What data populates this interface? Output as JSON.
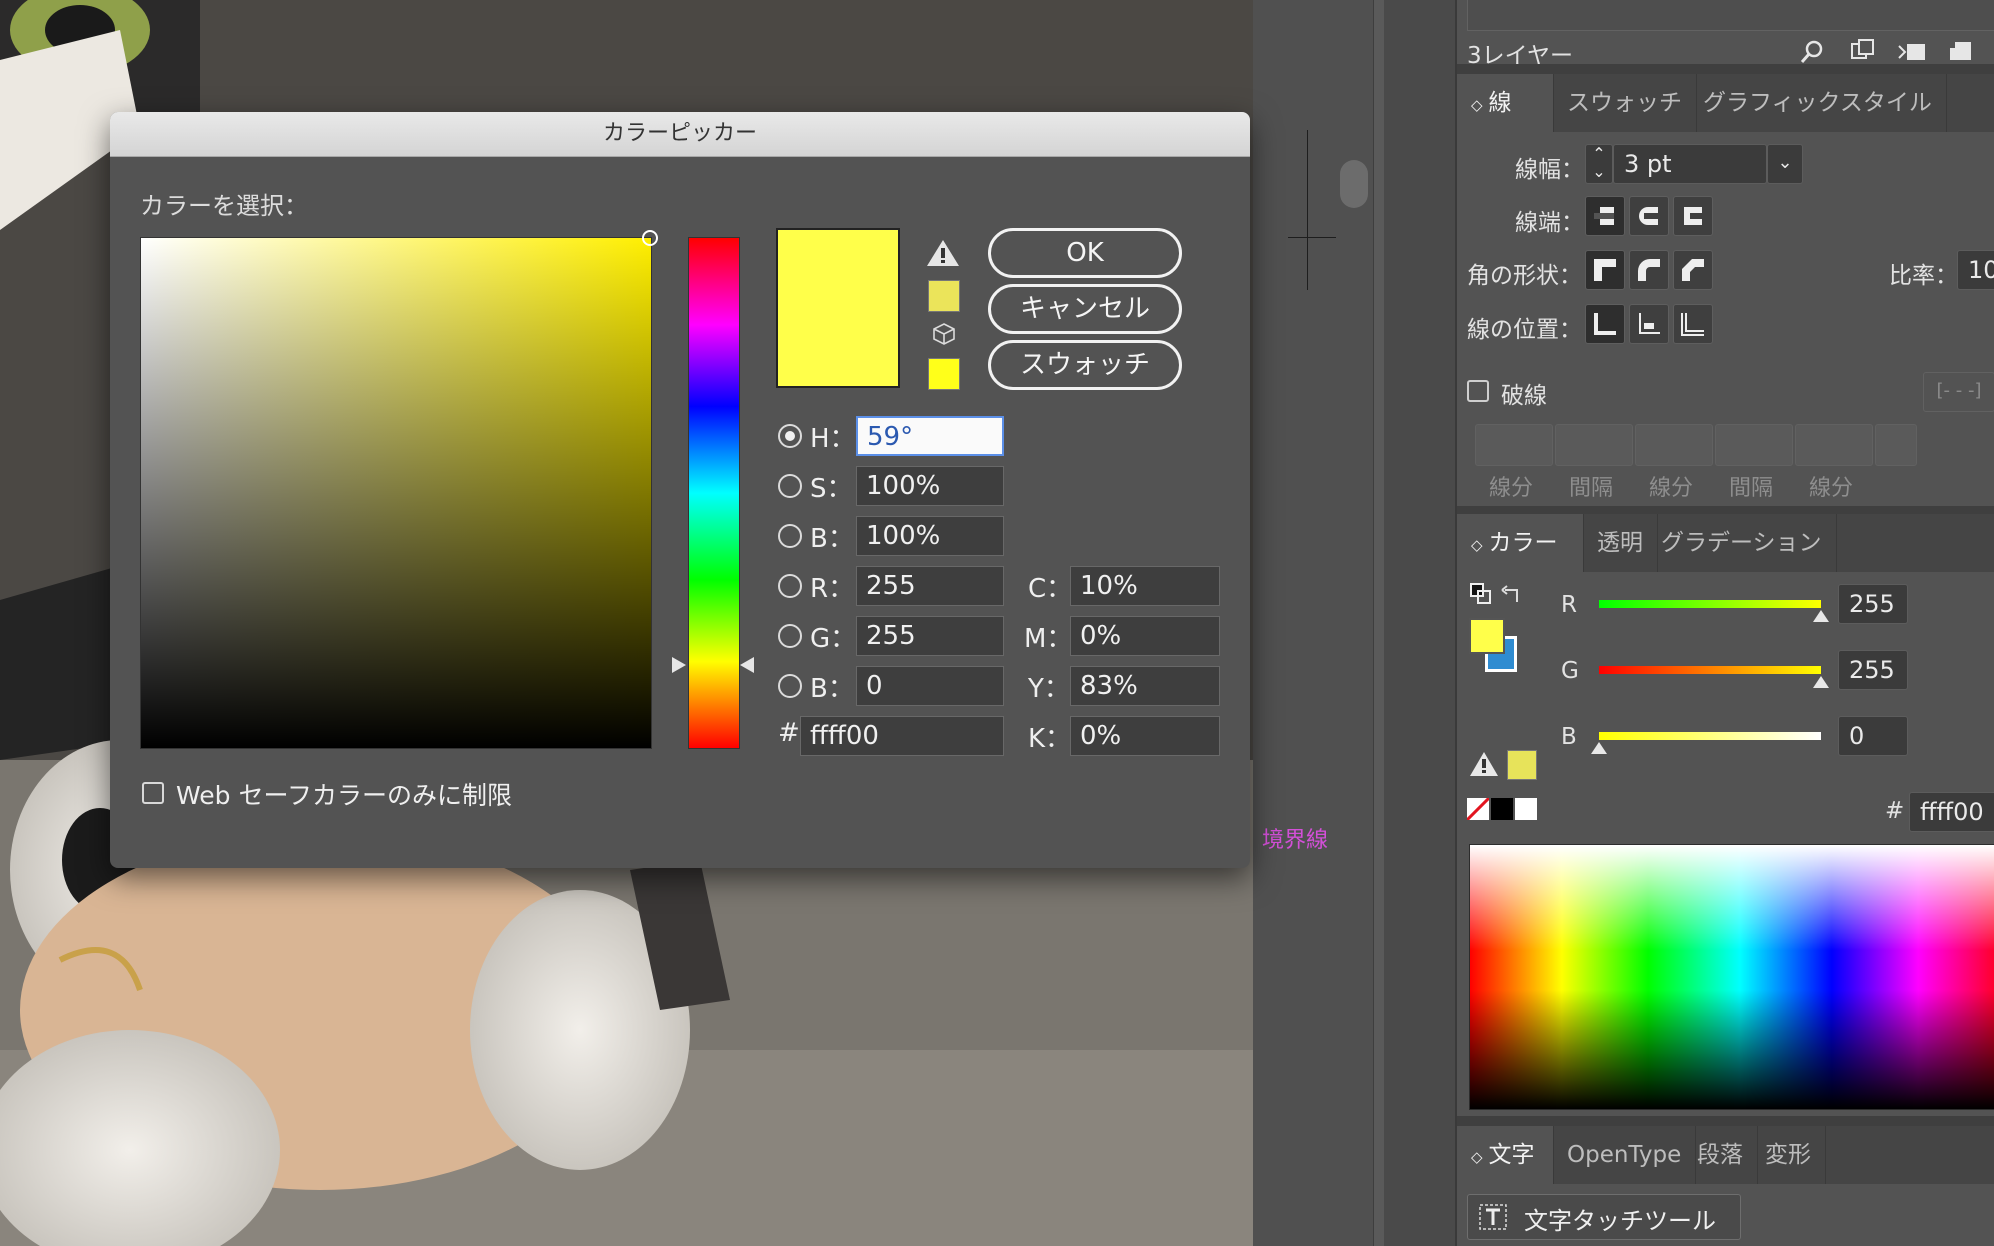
{
  "canvas": {
    "boundary_label": "境界線"
  },
  "panel": {
    "layers": {
      "title": "3レイヤー"
    },
    "stroke": {
      "tabs": [
        "線",
        "スウォッチ",
        "グラフィックスタイル"
      ],
      "weight_label": "線幅：",
      "weight_value": "3 pt",
      "cap_label": "線端：",
      "corner_label": "角の形状：",
      "ratio_label": "比率：",
      "ratio_value": "10",
      "align_label": "線の位置：",
      "dashed_label": "破線",
      "dash_labels": [
        "線分",
        "間隔",
        "線分",
        "間隔",
        "線分"
      ]
    },
    "color": {
      "tabs": [
        "カラー",
        "透明",
        "グラデーション"
      ],
      "r_label": "R",
      "r_value": "255",
      "g_label": "G",
      "g_value": "255",
      "b_label": "B",
      "b_value": "0",
      "hash": "#",
      "hex_value": "ffff00",
      "fill_color": "#ffff4a"
    },
    "type": {
      "tabs": [
        "文字",
        "OpenType",
        "段落",
        "変形"
      ],
      "touch_tool": "文字タッチツール"
    }
  },
  "dialog": {
    "title": "カラーピッカー",
    "select_label": "カラーを選択：",
    "buttons": {
      "ok": "OK",
      "cancel": "キャンセル",
      "swatches": "スウォッチ"
    },
    "fields": {
      "h": {
        "label": "H：",
        "value": "59°"
      },
      "s": {
        "label": "S：",
        "value": "100%"
      },
      "bri": {
        "label": "B：",
        "value": "100%"
      },
      "r": {
        "label": "R：",
        "value": "255"
      },
      "g": {
        "label": "G：",
        "value": "255"
      },
      "b": {
        "label": "B：",
        "value": "0"
      },
      "hex": {
        "label": "#",
        "value": "ffff00"
      },
      "c": {
        "label": "C：",
        "value": "10%"
      },
      "m": {
        "label": "M：",
        "value": "0%"
      },
      "y": {
        "label": "Y：",
        "value": "83%"
      },
      "k": {
        "label": "K：",
        "value": "0%"
      }
    },
    "web_safe_label": "Web セーフカラーのみに制限",
    "selected_color": "#ffff4a",
    "hue_color": "#ffef00"
  }
}
